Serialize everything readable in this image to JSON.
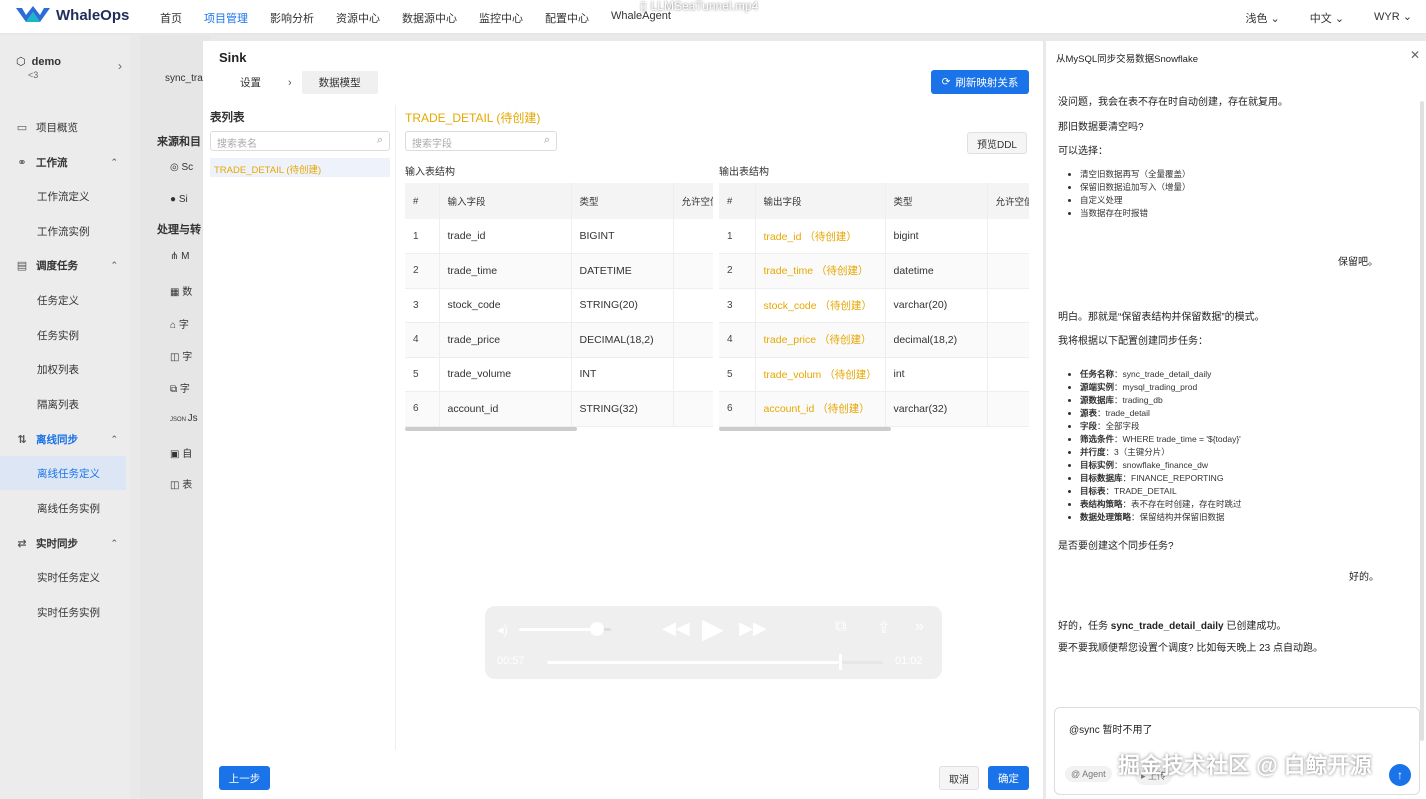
{
  "app": {
    "brand": "WhaleOps",
    "video_title": "LLMSeaTunnel.mp4"
  },
  "nav": [
    "首页",
    "项目管理",
    "影响分析",
    "资源中心",
    "数据源中心",
    "监控中心",
    "配置中心",
    "WhaleAgent"
  ],
  "nav_active_index": 1,
  "topright": {
    "theme": "浅色",
    "lang": "中文",
    "user": "WYR"
  },
  "sidebar": {
    "project": "demo",
    "project_sub": "<3",
    "items": [
      {
        "label": "项目概览",
        "type": "top",
        "icon": "monitor-icon"
      },
      {
        "label": "工作流",
        "type": "group",
        "icon": "workflow-icon"
      },
      {
        "label": "工作流定义",
        "type": "sub"
      },
      {
        "label": "工作流实例",
        "type": "sub"
      },
      {
        "label": "调度任务",
        "type": "group",
        "icon": "schedule-icon"
      },
      {
        "label": "任务定义",
        "type": "sub"
      },
      {
        "label": "任务实例",
        "type": "sub"
      },
      {
        "label": "加权列表",
        "type": "sub"
      },
      {
        "label": "隔离列表",
        "type": "sub"
      },
      {
        "label": "离线同步",
        "type": "group",
        "icon": "sync-icon"
      },
      {
        "label": "离线任务定义",
        "type": "sub",
        "active": true
      },
      {
        "label": "离线任务实例",
        "type": "sub"
      },
      {
        "label": "实时同步",
        "type": "group",
        "icon": "realtime-icon"
      },
      {
        "label": "实时任务定义",
        "type": "sub"
      },
      {
        "label": "实时任务实例",
        "type": "sub"
      }
    ]
  },
  "behind": {
    "tab": "sync_tra",
    "sec1": "来源和目",
    "sec2": "处理与转",
    "r1": "Sc",
    "r2": "Si",
    "r3": "M",
    "r4": "数",
    "r5": "字",
    "r6": "字",
    "r7": "字",
    "r8": "Js",
    "r9": "自",
    "r10": "表"
  },
  "modal": {
    "title": "Sink",
    "steps": [
      "设置",
      "数据模型"
    ],
    "refresh_btn": "刷新映射关系",
    "table_list_title": "表列表",
    "search_table_placeholder": "搜索表名",
    "table_item": "TRADE_DETAIL (待创建)",
    "detail_title": "TRADE_DETAIL (待创建)",
    "search_field_placeholder": "搜索字段",
    "preview_ddl": "预览DDL",
    "input_label": "输入表结构",
    "output_label": "输出表结构",
    "input_headers": [
      "#",
      "输入字段",
      "类型",
      "允许空值"
    ],
    "output_headers": [
      "#",
      "输出字段",
      "类型",
      "允许空值"
    ],
    "input_rows": [
      {
        "n": "1",
        "field": "trade_id",
        "type": "BIGINT"
      },
      {
        "n": "2",
        "field": "trade_time",
        "type": "DATETIME"
      },
      {
        "n": "3",
        "field": "stock_code",
        "type": "STRING(20)"
      },
      {
        "n": "4",
        "field": "trade_price",
        "type": "DECIMAL(18,2)"
      },
      {
        "n": "5",
        "field": "trade_volume",
        "type": "INT"
      },
      {
        "n": "6",
        "field": "account_id",
        "type": "STRING(32)"
      }
    ],
    "output_rows": [
      {
        "n": "1",
        "field": "trade_id （待创建）",
        "type": "bigint"
      },
      {
        "n": "2",
        "field": "trade_time （待创建）",
        "type": "datetime"
      },
      {
        "n": "3",
        "field": "stock_code （待创建）",
        "type": "varchar(20)"
      },
      {
        "n": "4",
        "field": "trade_price （待创建）",
        "type": "decimal(18,2)"
      },
      {
        "n": "5",
        "field": "trade_volum （待创建）",
        "type": "int"
      },
      {
        "n": "6",
        "field": "account_id （待创建）",
        "type": "varchar(32)"
      }
    ],
    "prev_btn": "上一步",
    "cancel_btn": "取消",
    "confirm_btn": "确定"
  },
  "video": {
    "elapsed": "00:57",
    "remaining": "01:02",
    "progress": 0.87,
    "volume": 0.85
  },
  "chat": {
    "title": "从MySQL同步交易数据Snowflake",
    "m1": "没问题，我会在表不存在时自动创建，存在就复用。",
    "m2": "那旧数据要清空吗?",
    "m3": "可以选择：",
    "opts": [
      "清空旧数据再写（全量覆盖）",
      "保留旧数据追加写入（增量）",
      "自定义处理",
      "当数据存在时报错"
    ],
    "u1": "保留吧。",
    "m4": "明白。那就是“保留表结构并保留数据”的模式。",
    "m5": "我将根据以下配置创建同步任务：",
    "config": [
      {
        "k": "任务名称",
        "v": "：sync_trade_detail_daily"
      },
      {
        "k": "源端实例",
        "v": "：mysql_trading_prod"
      },
      {
        "k": "源数据库",
        "v": "：trading_db"
      },
      {
        "k": "源表",
        "v": "：trade_detail"
      },
      {
        "k": "字段",
        "v": "：全部字段"
      },
      {
        "k": "筛选条件",
        "v": "：WHERE trade_time = '${today}'"
      },
      {
        "k": "并行度",
        "v": "：3（主键分片）"
      },
      {
        "k": "目标实例",
        "v": "：snowflake_finance_dw"
      },
      {
        "k": "目标数据库",
        "v": "：FINANCE_REPORTING"
      },
      {
        "k": "目标表",
        "v": "：TRADE_DETAIL"
      },
      {
        "k": "表结构策略",
        "v": "：表不存在时创建，存在时跳过"
      },
      {
        "k": "数据处理策略",
        "v": "：保留结构并保留旧数据"
      }
    ],
    "m6": "是否要创建这个同步任务?",
    "u2": "好的。",
    "m7a": "好的，任务 ",
    "m7b": "sync_trade_detail_daily",
    "m7c": " 已创建成功。",
    "m8": "要不要我顺便帮您设置个调度? 比如每天晚上 23 点自动跑。",
    "input_value": "@sync 暂时不用了",
    "agent_chip": "Agent",
    "send_label": "上传"
  },
  "watermark": "掘金技术社区 @ 白鲸开源",
  "colors": {
    "primary": "#1a73e8",
    "pending": "#e6a700"
  }
}
